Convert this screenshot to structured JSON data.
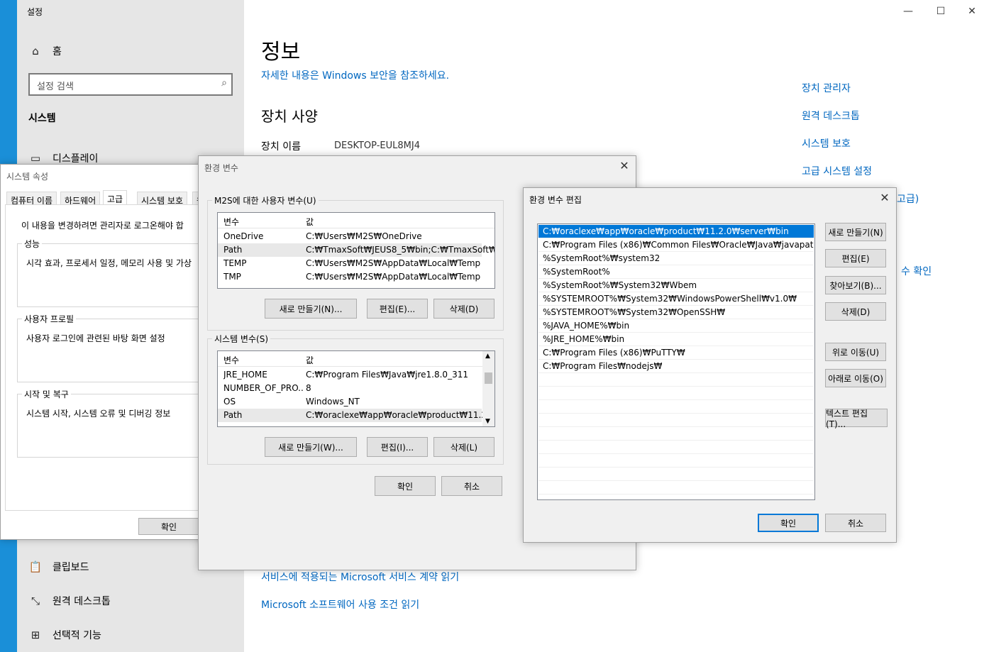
{
  "settings": {
    "window_title": "설정",
    "nav": {
      "home": "홈",
      "search_placeholder": "설정 검색",
      "section": "시스템",
      "display": "디스플레이",
      "clipboard": "클립보드",
      "remote_desktop": "원격 데스크톱",
      "optional_features": "선택적 기능"
    },
    "content": {
      "title": "정보",
      "security_link": "자세한 내용은 Windows 보안을 참조하세요.",
      "device_spec_heading": "장치 사양",
      "device_name_label": "장치 이름",
      "device_name_value": "DESKTOP-EUL8MJ4",
      "bottom_link1": "서비스에 적용되는 Microsoft 서비스 계약 읽기",
      "bottom_link2": "Microsoft 소프트웨어 사용 조건 읽기"
    },
    "related": {
      "device_manager": "장치 관리자",
      "remote_desktop": "원격 데스크톱",
      "system_protection": "시스템 보호",
      "advanced_settings": "고급 시스템 설정",
      "partial_1": "고급)",
      "partial_2": "수 확인"
    }
  },
  "sysprop": {
    "title": "시스템 속성",
    "tabs": [
      "컴퓨터 이름",
      "하드웨어",
      "고급",
      "시스템 보호",
      "원"
    ],
    "admin_note": "이 내용을 변경하려면 관리자로 로그온해야 합",
    "groups": [
      {
        "label": "성능",
        "desc": "시각 효과, 프로세서 일정, 메모리 사용 및 가상"
      },
      {
        "label": "사용자 프로필",
        "desc": "사용자 로그인에 관련된 바탕 화면 설정"
      },
      {
        "label": "시작 및 복구",
        "desc": "시스템 시작, 시스템 오류 및 디버깅 정보"
      }
    ],
    "ok": "확인"
  },
  "envvars": {
    "title": "환경 변수",
    "user_group": "M2S에 대한 사용자 변수(U)",
    "col_var": "변수",
    "col_val": "값",
    "user_vars": [
      {
        "name": "OneDrive",
        "value": "C:₩Users₩M2S₩OneDrive"
      },
      {
        "name": "Path",
        "value": "C:₩TmaxSoft₩JEUS8_5₩bin;C:₩TmaxSoft₩..."
      },
      {
        "name": "TEMP",
        "value": "C:₩Users₩M2S₩AppData₩Local₩Temp"
      },
      {
        "name": "TMP",
        "value": "C:₩Users₩M2S₩AppData₩Local₩Temp"
      }
    ],
    "user_new": "새로 만들기(N)...",
    "user_edit": "편집(E)...",
    "user_delete": "삭제(D)",
    "system_group": "시스템 변수(S)",
    "system_vars": [
      {
        "name": "JRE_HOME",
        "value": "C:₩Program Files₩Java₩jre1.8.0_311"
      },
      {
        "name": "NUMBER_OF_PRO...",
        "value": "8"
      },
      {
        "name": "OS",
        "value": "Windows_NT"
      },
      {
        "name": "Path",
        "value": "C:₩oraclexe₩app₩oracle₩product₩11.2.0..."
      }
    ],
    "sys_new": "새로 만들기(W)...",
    "sys_edit": "편집(I)...",
    "sys_delete": "삭제(L)",
    "ok": "확인",
    "cancel": "취소"
  },
  "editenv": {
    "title": "환경 변수 편집",
    "paths": [
      "C:₩oraclexe₩app₩oracle₩product₩11.2.0₩server₩bin",
      "C:₩Program Files (x86)₩Common Files₩Oracle₩Java₩javapath",
      "%SystemRoot%₩system32",
      "%SystemRoot%",
      "%SystemRoot%₩System32₩Wbem",
      "%SYSTEMROOT%₩System32₩WindowsPowerShell₩v1.0₩",
      "%SYSTEMROOT%₩System32₩OpenSSH₩",
      "%JAVA_HOME%₩bin",
      "%JRE_HOME%₩bin",
      "C:₩Program Files (x86)₩PuTTY₩",
      "C:₩Program Files₩nodejs₩"
    ],
    "buttons": {
      "new": "새로 만들기(N)",
      "edit": "편집(E)",
      "browse": "찾아보기(B)...",
      "delete": "삭제(D)",
      "move_up": "위로 이동(U)",
      "move_down": "아래로 이동(O)",
      "edit_text": "텍스트 편집(T)..."
    },
    "ok": "확인",
    "cancel": "취소"
  },
  "icons": {
    "home": "home-icon",
    "search": "search-icon",
    "display": "monitor-icon",
    "clipboard": "clipboard-icon",
    "remote": "remote-desktop-icon",
    "optional": "grid-icon",
    "close": "close-icon",
    "minimize": "minimize-icon",
    "maximize": "maximize-icon"
  },
  "colors": {
    "link": "#0067c0",
    "selection": "#0078d7",
    "desktop": "#1e9be6"
  }
}
